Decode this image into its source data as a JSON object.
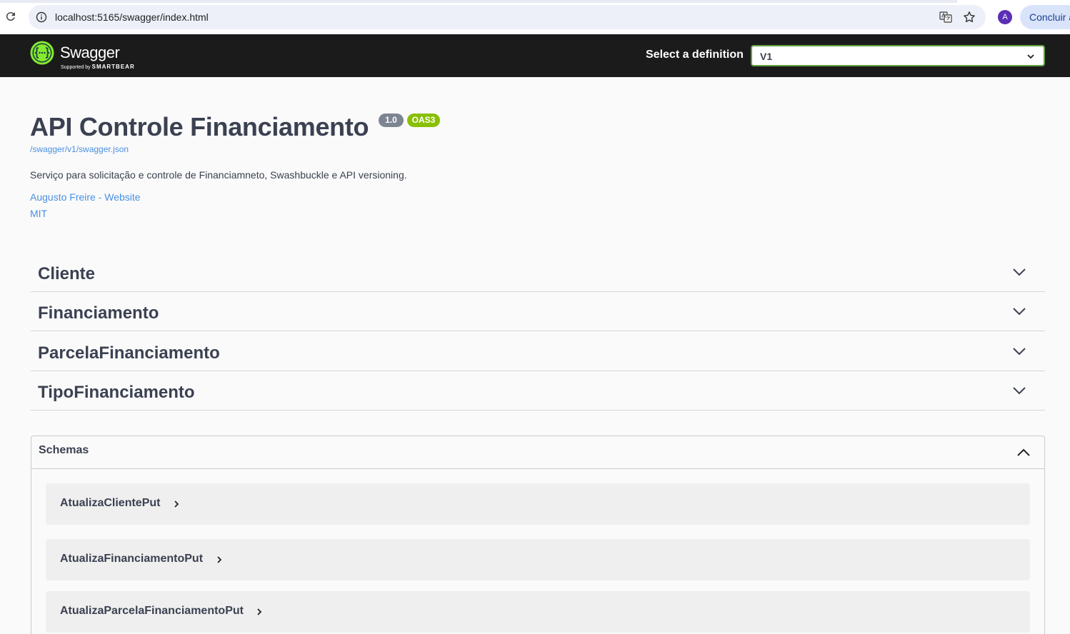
{
  "browser": {
    "url": "localhost:5165/swagger/index.html",
    "avatar_letter": "A",
    "finish_label": "Concluir a"
  },
  "topbar": {
    "logo_text": "Swagger",
    "logo_sub_small": "Supported by",
    "logo_sub_brand": "SMARTBEAR",
    "select_label": "Select a definition",
    "select_value": "V1"
  },
  "info": {
    "title": "API Controle Financiamento",
    "version": "1.0",
    "oas_badge": "OAS3",
    "spec_url": "/swagger/v1/swagger.json",
    "description": "Serviço para solicitação e controle de Financiamneto, Swashbuckle e API versioning.",
    "contact": "Augusto Freire - Website",
    "license": "MIT"
  },
  "tags": [
    {
      "name": "Cliente"
    },
    {
      "name": "Financiamento"
    },
    {
      "name": "ParcelaFinanciamento"
    },
    {
      "name": "TipoFinanciamento"
    }
  ],
  "schemas": {
    "title": "Schemas",
    "models": [
      {
        "name": "AtualizaClientePut"
      },
      {
        "name": "AtualizaFinanciamentoPut"
      },
      {
        "name": "AtualizaParcelaFinanciamentoPut"
      }
    ]
  },
  "colors": {
    "topbar_bg": "#1b1b1b",
    "select_border": "#62a03f",
    "link": "#4990e2",
    "oas_badge": "#89bf04",
    "version_badge": "#7d8492"
  },
  "icons": [
    "reload-icon",
    "site-info-icon",
    "translate-icon",
    "star-icon",
    "swagger-logo-icon",
    "chevron-down-icon",
    "chevron-up-icon",
    "chevron-right-icon"
  ]
}
